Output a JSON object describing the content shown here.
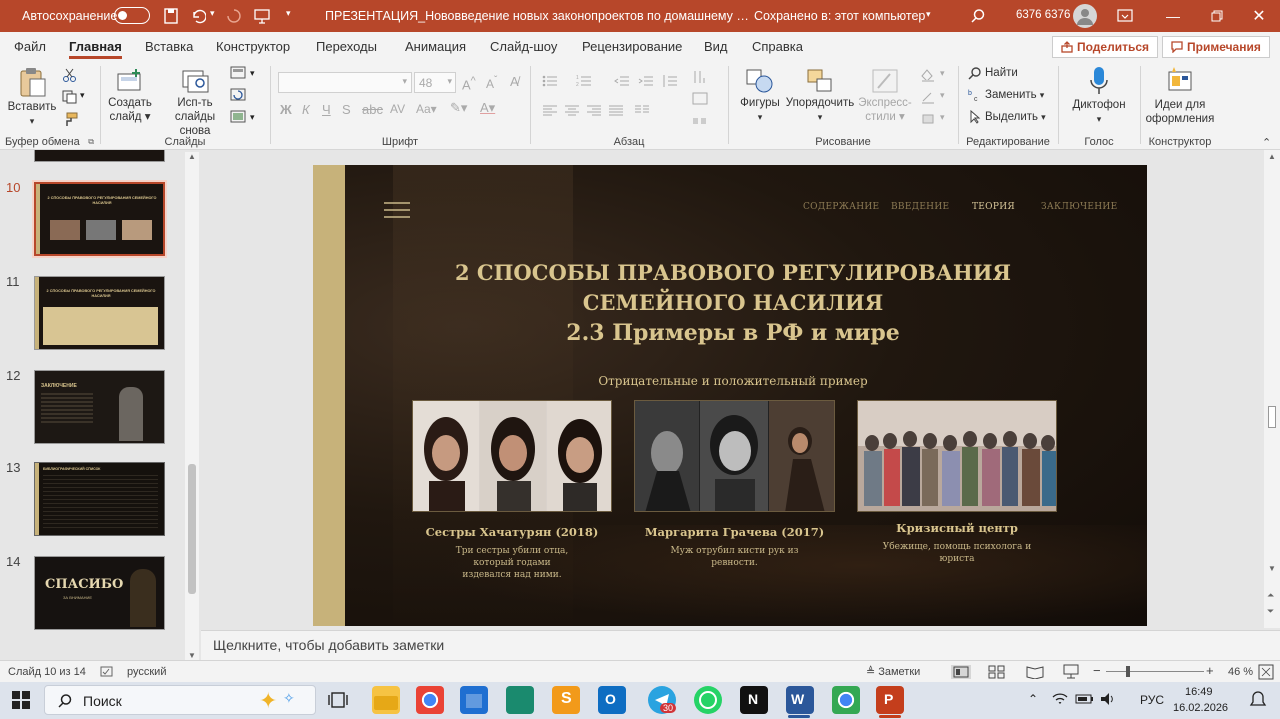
{
  "titlebar": {
    "autosave_label": "Автосохранение",
    "doc_title": "ПРЕЗЕНТАЦИЯ_Нововведение новых законопроектов по домашнему насилию в...",
    "save_state": "Сохранено в: этот компьютер",
    "user_name": "6376 6376"
  },
  "menu": {
    "tabs": [
      "Файл",
      "Главная",
      "Вставка",
      "Конструктор",
      "Переходы",
      "Анимация",
      "Слайд-шоу",
      "Рецензирование",
      "Вид",
      "Справка"
    ],
    "share": "Поделиться",
    "comments": "Примечания"
  },
  "ribbon": {
    "paste": "Вставить",
    "new_slide_1": "Создать",
    "new_slide_2": "слайд",
    "reuse_1": "Исп-ть",
    "reuse_2": "слайды снова",
    "font_size": "48",
    "shapes": "Фигуры",
    "arrange": "Упорядочить",
    "quick_styles_1": "Экспресс-",
    "quick_styles_2": "стили",
    "find": "Найти",
    "replace": "Заменить",
    "select": "Выделить",
    "dictate": "Диктофон",
    "designer_1": "Идеи для",
    "designer_2": "оформления",
    "groups": [
      "Буфер обмена",
      "Слайды",
      "Шрифт",
      "Абзац",
      "Рисование",
      "Редактирование",
      "Голос",
      "Конструктор"
    ]
  },
  "thumbnails": [
    {
      "num": "10",
      "title": "2 СПОСОБЫ ПРАВОВОГО РЕГУЛИРОВАНИЯ СЕМЕЙНОГО НАСИЛИЯ"
    },
    {
      "num": "11",
      "title": "2 СПОСОБЫ ПРАВОВОГО РЕГУЛИРОВАНИЯ СЕМЕЙНОГО НАСИЛИЯ"
    },
    {
      "num": "12",
      "title": "ЗАКЛЮЧЕНИЕ"
    },
    {
      "num": "13",
      "title": "БИБЛИОГРАФИЧЕСКИЙ СПИСОК"
    },
    {
      "num": "14",
      "title": "СПАСИБО",
      "subtitle": "ЗА ВНИМАНИЕ"
    }
  ],
  "slide": {
    "nav": [
      "СОДЕРЖАНИЕ",
      "ВВЕДЕНИЕ",
      "ТЕОРИЯ",
      "ЗАКЛЮЧЕНИЕ"
    ],
    "nav_active": "ТЕОРИЯ",
    "title_line1": "2 СПОСОБЫ ПРАВОВОГО РЕГУЛИРОВАНИЯ",
    "title_line2": "СЕМЕЙНОГО НАСИЛИЯ",
    "title_line3": "2.3 Примеры в РФ и мире",
    "subheading": "Отрицательные и положительный пример",
    "cards": [
      {
        "title": "Сестры Хачатурян (2018)",
        "desc_1": "Три сестры убили отца,",
        "desc_2": "который годами",
        "desc_3": "издевался над ними."
      },
      {
        "title": "Маргарита Грачева (2017)",
        "desc_1": "Муж отрубил кисти рук из",
        "desc_2": "ревности."
      },
      {
        "title": "Кризисный центр",
        "desc_1": "Убежище, помощь психолога и",
        "desc_2": "юриста"
      }
    ]
  },
  "notes_placeholder": "Щелкните, чтобы добавить заметки",
  "status": {
    "slide_counter": "Слайд 10 из 14",
    "language": "русский",
    "notes_btn": "Заметки",
    "zoom": "46 %"
  },
  "taskbar": {
    "search": "Поиск",
    "lang": "РУС",
    "time": "16:49",
    "date": "16.02.2026",
    "telegram_badge": "30"
  },
  "colors": {
    "accent": "#b7472a",
    "slide_gold": "#d9c58e"
  }
}
